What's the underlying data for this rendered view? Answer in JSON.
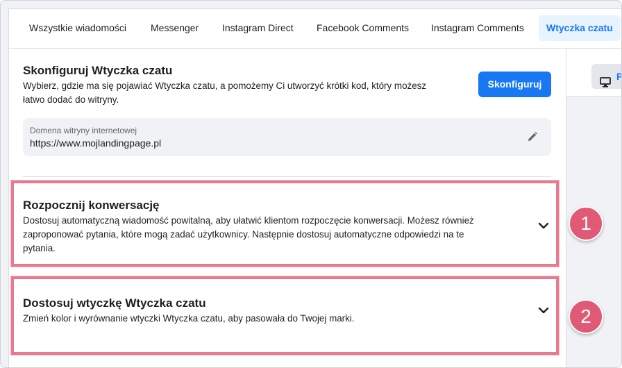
{
  "tabs": [
    {
      "label": "Wszystkie wiadomości"
    },
    {
      "label": "Messenger"
    },
    {
      "label": "Instagram Direct"
    },
    {
      "label": "Facebook Comments"
    },
    {
      "label": "Instagram Comments"
    },
    {
      "label": "Wtyczka czatu",
      "active": true
    }
  ],
  "configure": {
    "title": "Skonfiguruj Wtyczka czatu",
    "description_line1": "Wybierz, gdzie ma się pojawiać Wtyczka czatu, a pomożemy Ci utworzyć krótki kod, który możesz",
    "description_line2": "łatwo dodać do witryny.",
    "button_label": "Skonfiguruj"
  },
  "domain": {
    "label": "Domena witryny internetowej",
    "value": "https://www.mojlandingpage.pl",
    "edit_icon": "pencil-icon"
  },
  "sections": [
    {
      "title": "Rozpocznij konwersację",
      "line1": "Dostosuj automatyczną wiadomość powitalną, aby ułatwić klientom rozpoczęcie konwersacji. Możesz również",
      "line2": "zaproponować pytania, które mogą zadać użytkownicy. Następnie dostosuj automatyczne odpowiedzi na te",
      "line3": "pytania.",
      "badge": "1"
    },
    {
      "title": "Dostosuj wtyczkę Wtyczka czatu",
      "line1": "Zmień kolor i wyrównanie wtyczki Wtyczka czatu, aby pasowała do Twojej marki.",
      "badge": "2"
    }
  ],
  "right_panel": {
    "preview_label": "Po",
    "preview_icon": "monitor-icon"
  },
  "colors": {
    "accent": "#1877f2",
    "highlight_border": "#e8798e",
    "badge": "#e05a76"
  }
}
